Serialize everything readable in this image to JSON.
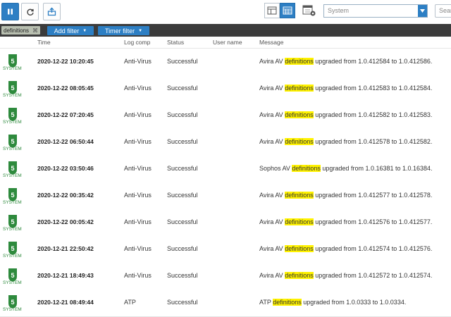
{
  "toolbar": {
    "source_select": {
      "value": "System"
    },
    "search": {
      "placeholder": "Search"
    }
  },
  "filters": {
    "chip_label": "definitions",
    "add_filter_label": "Add filter",
    "timer_filter_label": "Timer filter"
  },
  "table": {
    "columns": {
      "time": "Time",
      "log_comp": "Log comp",
      "status": "Status",
      "user_name": "User name",
      "message": "Message"
    },
    "rows": [
      {
        "icon_label": "SYSTEM",
        "time": "2020-12-22 10:20:45",
        "log_comp": "Anti-Virus",
        "status": "Successful",
        "user": "",
        "msg_before": "Avira AV ",
        "msg_highlight": "definitions",
        "msg_after": " upgraded from 1.0.412584 to 1.0.412586."
      },
      {
        "icon_label": "SYSTEM",
        "time": "2020-12-22 08:05:45",
        "log_comp": "Anti-Virus",
        "status": "Successful",
        "user": "",
        "msg_before": "Avira AV ",
        "msg_highlight": "definitions",
        "msg_after": " upgraded from 1.0.412583 to 1.0.412584."
      },
      {
        "icon_label": "SYSTEM",
        "time": "2020-12-22 07:20:45",
        "log_comp": "Anti-Virus",
        "status": "Successful",
        "user": "",
        "msg_before": "Avira AV ",
        "msg_highlight": "definitions",
        "msg_after": " upgraded from 1.0.412582 to 1.0.412583."
      },
      {
        "icon_label": "SYSTEM",
        "time": "2020-12-22 06:50:44",
        "log_comp": "Anti-Virus",
        "status": "Successful",
        "user": "",
        "msg_before": "Avira AV ",
        "msg_highlight": "definitions",
        "msg_after": " upgraded from 1.0.412578 to 1.0.412582."
      },
      {
        "icon_label": "SYSTEM",
        "time": "2020-12-22 03:50:46",
        "log_comp": "Anti-Virus",
        "status": "Successful",
        "user": "",
        "msg_before": "Sophos AV ",
        "msg_highlight": "definitions",
        "msg_after": " upgraded from 1.0.16381 to 1.0.16384."
      },
      {
        "icon_label": "SYSTEM",
        "time": "2020-12-22 00:35:42",
        "log_comp": "Anti-Virus",
        "status": "Successful",
        "user": "",
        "msg_before": "Avira AV ",
        "msg_highlight": "definitions",
        "msg_after": " upgraded from 1.0.412577 to 1.0.412578."
      },
      {
        "icon_label": "SYSTEM",
        "time": "2020-12-22 00:05:42",
        "log_comp": "Anti-Virus",
        "status": "Successful",
        "user": "",
        "msg_before": "Avira AV ",
        "msg_highlight": "definitions",
        "msg_after": " upgraded from 1.0.412576 to 1.0.412577."
      },
      {
        "icon_label": "SYSTEM",
        "time": "2020-12-21 22:50:42",
        "log_comp": "Anti-Virus",
        "status": "Successful",
        "user": "",
        "msg_before": "Avira AV ",
        "msg_highlight": "definitions",
        "msg_after": " upgraded from 1.0.412574 to 1.0.412576."
      },
      {
        "icon_label": "SYSTEM",
        "time": "2020-12-21 18:49:43",
        "log_comp": "Anti-Virus",
        "status": "Successful",
        "user": "",
        "msg_before": "Avira AV ",
        "msg_highlight": "definitions",
        "msg_after": " upgraded from 1.0.412572 to 1.0.412574."
      },
      {
        "icon_label": "SYSTEM",
        "time": "2020-12-21 08:49:44",
        "log_comp": "ATP",
        "status": "Successful",
        "user": "",
        "msg_before": "ATP ",
        "msg_highlight": "definitions",
        "msg_after": " upgraded from 1.0.0333 to 1.0.0334."
      }
    ]
  },
  "colors": {
    "accent_blue": "#2d7fc4",
    "filter_bar": "#3c3c3c",
    "system_icon_green": "#2e8a3d",
    "highlight": "#fff200"
  },
  "icons": {
    "toolbar": [
      "pause-icon",
      "refresh-icon",
      "export-icon"
    ],
    "views": [
      "split-view-icon",
      "table-view-icon",
      "calendar-settings-icon"
    ],
    "row": "system-shield-icon"
  }
}
